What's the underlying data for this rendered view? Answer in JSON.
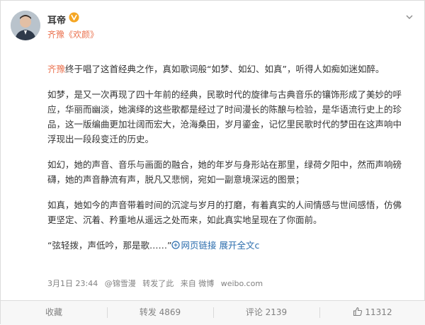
{
  "post": {
    "username": "耳帝",
    "source_prefix": "齐豫",
    "source_link": "《欢颜》",
    "paragraphs": {
      "p1": {
        "mention": "齐豫",
        "text": "终于唱了这首经典之作，真如歌词般“如梦、如幻、如真”，听得人如痴如迷如醉。"
      },
      "p2": "如梦，是又一次再现了四十年前的经典，民歌时代的旋律与古典音乐的镶饰形成了美妙的呼应，华丽而幽淡，她演绎的这些歌都是经过了时间漫长的陈酿与检验，是华语流行史上的珍品，这一版编曲更加壮阔而宏大，沧海桑田，岁月鎏金，记忆里民歌时代的梦田在这声响中浮现出一段段变迁的历史。",
      "p3": "如幻，她的声音、音乐与画面的融合，她的年岁与身形站在那里，绿荷夕阳中，然而声响磅礴，她的声音静流有声，脱凡又悲悯，宛如一副意境深远的图景；",
      "p4": "如真，她如今的声音带着时间的沉淀与岁月的打磨，有着真实的人间情感与世间感悟，仿佛更坚定、沉着、矜重地从遥远之处而来，如此真实地呈现在了你面前。",
      "p5": {
        "quote": "“弦轻拨，声低吟，那是歌……”",
        "webpage_link": "网页链接",
        "expand": "展开全文",
        "expand_arrow": "c"
      }
    },
    "meta": {
      "date": "3月1日 23:44",
      "from": "@锦雪漫",
      "reposted": "转发了此",
      "via": "来自 微博",
      "site": "weibo.com"
    }
  },
  "actions": {
    "favorite": "收藏",
    "repost": "转发 4869",
    "comment": "评论 2139",
    "like": "11312"
  },
  "colors": {
    "link": "#eb7350",
    "blue_link": "#2b6dad",
    "verified_badge": "#f5a623"
  }
}
